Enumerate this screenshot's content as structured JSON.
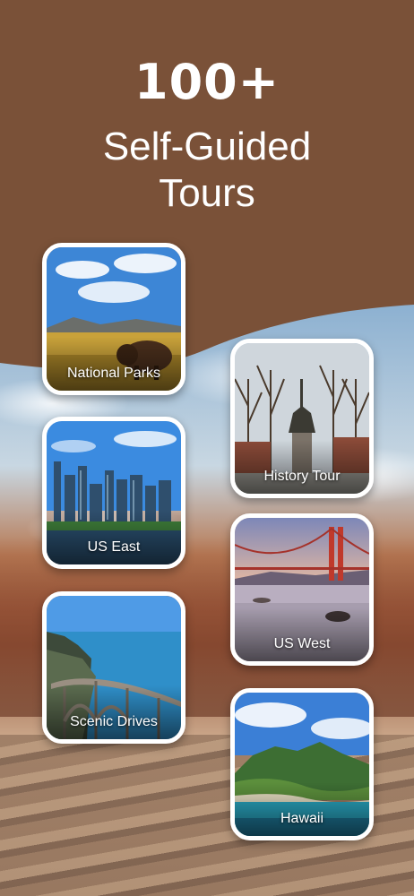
{
  "hero": {
    "headline_number": "100+",
    "headline_line1": "Self-Guided",
    "headline_line2": "Tours"
  },
  "colors": {
    "brand_brown": "#7a5138",
    "tile_border": "#ffffff",
    "text": "#ffffff"
  },
  "tiles": [
    {
      "id": "national-parks",
      "label": "National Parks"
    },
    {
      "id": "history-tour",
      "label": "History Tour"
    },
    {
      "id": "us-east",
      "label": "US East"
    },
    {
      "id": "us-west",
      "label": "US West"
    },
    {
      "id": "scenic-drives",
      "label": "Scenic Drives"
    },
    {
      "id": "hawaii",
      "label": "Hawaii"
    }
  ]
}
